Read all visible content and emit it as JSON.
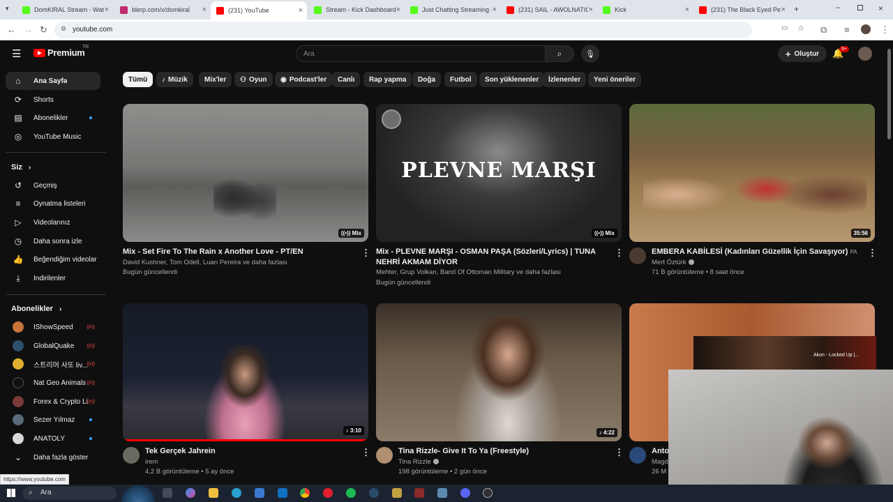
{
  "browser": {
    "tabs": [
      {
        "title": "DomKIRAL Stream - Watc",
        "favicon_color": "#53fc18"
      },
      {
        "title": "blerp.com/x/domkiral",
        "favicon_color": "#c02a6e"
      },
      {
        "title": "(231) YouTube",
        "favicon_color": "#ff0000"
      },
      {
        "title": "Stream - Kick Dashboard",
        "favicon_color": "#53fc18"
      },
      {
        "title": "Just Chatting Streaming -",
        "favicon_color": "#53fc18"
      },
      {
        "title": "(231) SAIL - AWOLNATIO",
        "favicon_color": "#ff0000"
      },
      {
        "title": "Kick",
        "favicon_color": "#53fc18"
      },
      {
        "title": "(231) The Black Eyed Pea",
        "favicon_color": "#ff0000"
      }
    ],
    "url": "youtube.com",
    "status_url": "https://www.youtube.com"
  },
  "youtube": {
    "logo_text": "Premium",
    "region": "TR",
    "search_placeholder": "Ara",
    "create_label": "Oluştur",
    "notification_count": "9+"
  },
  "sidebar": {
    "main": [
      {
        "label": "Ana Sayfa",
        "icon": "home-icon"
      },
      {
        "label": "Shorts",
        "icon": "shorts-icon"
      },
      {
        "label": "Abonelikler",
        "icon": "subscriptions-icon"
      },
      {
        "label": "YouTube Music",
        "icon": "music-icon"
      }
    ],
    "you_header": "Siz",
    "you": [
      {
        "label": "Geçmiş",
        "icon": "history-icon"
      },
      {
        "label": "Oynatma listeleri",
        "icon": "playlist-icon"
      },
      {
        "label": "Videolarınız",
        "icon": "video-icon"
      },
      {
        "label": "Daha sonra izle",
        "icon": "clock-icon"
      },
      {
        "label": "Beğendiğim videolar",
        "icon": "thumbs-up-icon"
      },
      {
        "label": "İndirilenler",
        "icon": "download-icon"
      }
    ],
    "subs_header": "Abonelikler",
    "subs": [
      {
        "label": "IShowSpeed",
        "avatar_color": "#c8733a"
      },
      {
        "label": "GlobalQuake",
        "avatar_color": "#2f4f6f"
      },
      {
        "label": "스트리머 사또 liv...",
        "avatar_color": "#e0b030"
      },
      {
        "label": "Nat Geo Animals",
        "avatar_color": "#111111"
      },
      {
        "label": "Forex & Crypto Li...",
        "avatar_color": "#7a3a3a"
      },
      {
        "label": "Sezer Yılmaz",
        "avatar_color": "#5a6a7a"
      },
      {
        "label": "ANATOLY",
        "avatar_color": "#d8d8d8"
      }
    ],
    "show_more": "Daha fazla göster"
  },
  "chips": [
    "Tümü",
    "Müzik",
    "Mix'ler",
    "Oyun",
    "Podcast'ler",
    "Canlı",
    "Rap yapma",
    "Doğa",
    "Futbol",
    "Son yüklenenler",
    "İzlenenler",
    "Yeni öneriler"
  ],
  "videos": [
    {
      "title": "Mix - Set Fire To The Rain x Another Love - PT/EN",
      "line1": "David Kushner, Tom Odell, Luan Pereira ve daha fazlası",
      "line2": "Bugün güncellendi",
      "badge": "Mix"
    },
    {
      "title": "Mix - PLEVNE MARŞI - OSMAN PAŞA (Sözleri/Lyrics) | TUNA NEHRİ AKMAM DİYOR",
      "line1": "Mehter, Grup Volkan, Band Of Ottoman Military ve daha fazlası",
      "line2": "Bugün güncellendi",
      "badge": "Mix",
      "thumb_text": "PLEVNE MARŞI"
    },
    {
      "title": "EMBERA KABİLESİ (Kadınları Güzellik İçin Savaşıyor)",
      "title_tag": "PA",
      "line1": "Mert Öztürk",
      "line2": "71 B görüntüleme • 8 saat önce",
      "badge": "35:56"
    },
    {
      "title": "Tek Gerçek Jahrein",
      "line1": "irem",
      "line2": "4,2 B görüntüleme • 5 ay önce",
      "badge": "3:10"
    },
    {
      "title": "Tina Rizzle- Give It To Ya (Freestyle)",
      "line1": "Tina Rizzle",
      "line2": "198 görüntüleme • 2 gün önce",
      "badge": "4:22"
    },
    {
      "title": "Anton",
      "line1": "Magd",
      "line2": "26 M",
      "overlay_text": "Akon - Locked Up |..."
    }
  ],
  "taskbar": {
    "search_label": "Ara"
  }
}
